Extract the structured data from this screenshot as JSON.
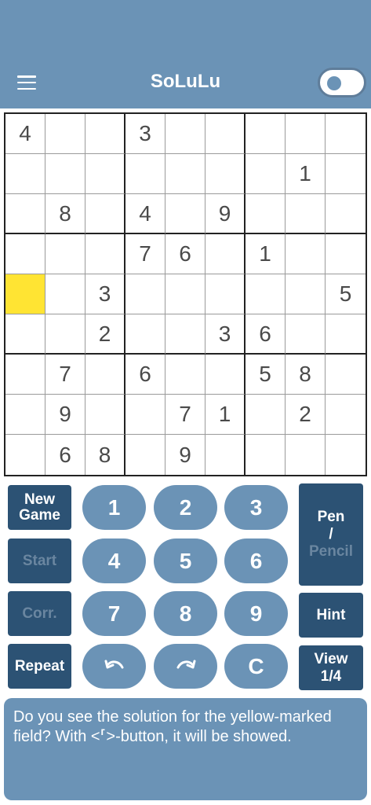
{
  "header": {
    "title": "SoLuLu",
    "menu_icon": "hamburger-menu-icon",
    "toggle_state": "off"
  },
  "grid": {
    "rows": [
      [
        "4",
        "",
        "",
        "3",
        "",
        "",
        "",
        "",
        ""
      ],
      [
        "",
        "",
        "",
        "",
        "",
        "",
        "",
        "1",
        ""
      ],
      [
        "",
        "8",
        "",
        "4",
        "",
        "9",
        "",
        "",
        ""
      ],
      [
        "",
        "",
        "",
        "7",
        "6",
        "",
        "1",
        "",
        ""
      ],
      [
        "",
        "",
        "3",
        "",
        "",
        "",
        "",
        "",
        "5"
      ],
      [
        "",
        "",
        "2",
        "",
        "",
        "3",
        "6",
        "",
        ""
      ],
      [
        "",
        "7",
        "",
        "6",
        "",
        "",
        "5",
        "8",
        ""
      ],
      [
        "",
        "9",
        "",
        "",
        "7",
        "1",
        "",
        "2",
        ""
      ],
      [
        "",
        "6",
        "8",
        "",
        "9",
        "",
        "",
        "",
        ""
      ]
    ],
    "selected_cell": {
      "row": 4,
      "col": 0
    },
    "selected_color": "#ffe433"
  },
  "left_buttons": {
    "new_game": "New Game",
    "start": "Start",
    "corr": "Corr.",
    "repeat": "Repeat"
  },
  "numpad": {
    "n1": "1",
    "n2": "2",
    "n3": "3",
    "n4": "4",
    "n5": "5",
    "n6": "6",
    "n7": "7",
    "n8": "8",
    "n9": "9",
    "clear": "C",
    "undo_icon": "undo-icon",
    "redo_icon": "redo-icon"
  },
  "right_buttons": {
    "pen": "Pen",
    "slash": "/",
    "pencil": "Pencil",
    "hint": "Hint",
    "view": "View",
    "view_page": "1/4"
  },
  "message": {
    "text": "Do you see the solution for the yellow-marked field? With <⸢>-button, it will be showed."
  },
  "colors": {
    "primary": "#6b93b6",
    "dark": "#2c5274",
    "highlight": "#ffe433"
  }
}
